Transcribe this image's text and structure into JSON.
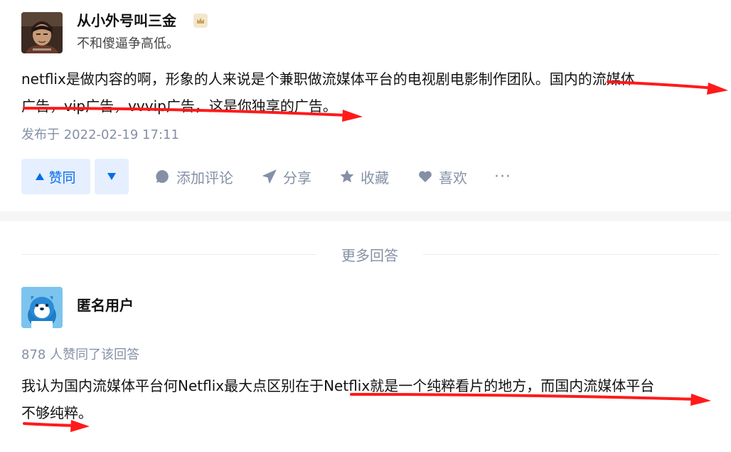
{
  "answer": {
    "author_name": "从小外号叫三金",
    "author_bio": "不和傻逼争高低。",
    "content_line1": "netflix是做内容的啊，形象的人来说是个兼职做流媒体平台的电视剧电影制作团队。国内的流媒体..",
    "content_line2": "广告，vip广告，vvvip广告，这是你独享的广告。",
    "published": "发布于 2022-02-19 17:11",
    "actions": {
      "upvote_label": "赞同",
      "comment_label": "添加评论",
      "share_label": "分享",
      "collect_label": "收藏",
      "like_label": "喜欢",
      "more_label": "···"
    }
  },
  "more_answers_title": "更多回答",
  "answer2": {
    "author_name": "匿名用户",
    "vote_count": "878 人赞同了该回答",
    "content_line1": "我认为国内流媒体平台何Netflix最大点区别在于Netflix就是一个纯粹看片的地方，而国内流媒体平台",
    "content_line2": "不够纯粹。"
  },
  "colors": {
    "accent": "#056de8",
    "accent_bg": "#e5efff",
    "meta_gray": "#8590a6",
    "annotation_red": "#ff1a1a"
  }
}
